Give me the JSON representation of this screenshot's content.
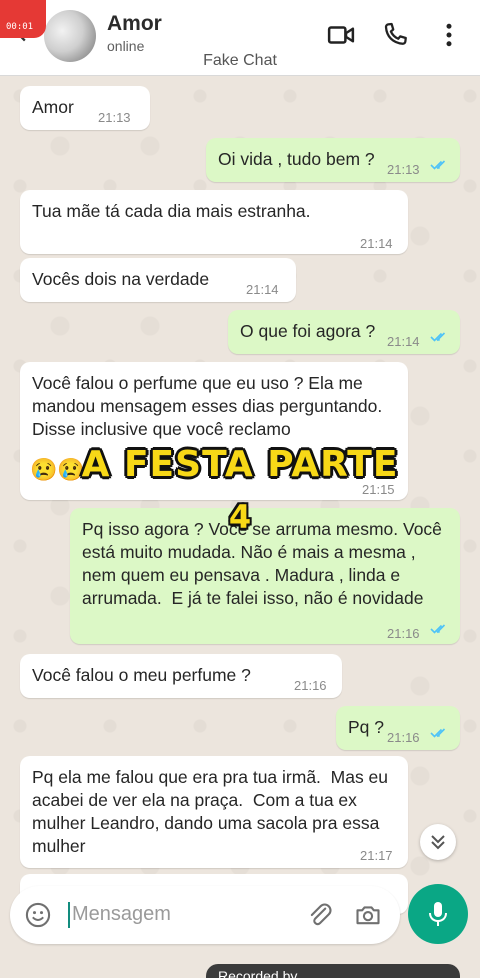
{
  "header": {
    "contact_name": "Amor",
    "status": "online",
    "chat_title": "Fake Chat",
    "rec_badge": "00:01"
  },
  "messages": [
    {
      "dir": "in",
      "text": "Amor",
      "time": "21:13"
    },
    {
      "dir": "out",
      "text": "Oi vida , tudo bem ?",
      "time": "21:13",
      "read": true
    },
    {
      "dir": "in",
      "text": "Tua mãe tá cada dia mais estranha.",
      "time": "21:14"
    },
    {
      "dir": "in",
      "text": "Vocês dois na verdade",
      "time": "21:14"
    },
    {
      "dir": "out",
      "text": "O que foi agora ?",
      "time": "21:14",
      "read": true
    },
    {
      "dir": "in",
      "text": "Você falou o perfume que eu uso ? Ela me mandou mensagem esses dias perguntando. Disse inclusive que você reclamo",
      "emoji": "😢😢",
      "time": "21:15"
    },
    {
      "dir": "out",
      "text": "Pq isso agora ? Você se arruma mesmo. Você está muito mudada. Não é mais a mesma , nem quem eu pensava . Madura , linda e arrumada.  E já te falei isso, não é novidade",
      "time": "21:16",
      "read": true
    },
    {
      "dir": "in",
      "text": "Você falou o meu perfume ?",
      "time": "21:16"
    },
    {
      "dir": "out",
      "text": "Pq ?",
      "time": "21:16",
      "read": true
    },
    {
      "dir": "in",
      "text": "Pq ela me falou que era pra tua irmã.  Mas eu acabei de ver ela na praça.  Com a tua ex mulher Leandro, dando uma sacola pra essa mulher",
      "time": "21:17"
    }
  ],
  "overlay": {
    "title": "A FESTA PARTE",
    "number": "4"
  },
  "input": {
    "placeholder": "Mensagem"
  },
  "footer": {
    "recorded_label": "Recorded by"
  },
  "colors": {
    "incoming_bubble": "#ffffff",
    "outgoing_bubble": "#dcf8c6",
    "chat_background": "#ece5dd",
    "accent_green": "#0aa785",
    "read_ticks": "#4fc3f7",
    "overlay_text": "#f7d817"
  },
  "icons": [
    "back-arrow-icon",
    "video-call-icon",
    "phone-icon",
    "more-vert-icon",
    "emoji-icon",
    "attach-icon",
    "camera-icon",
    "mic-icon",
    "chevron-double-down-icon",
    "double-check-icon"
  ]
}
